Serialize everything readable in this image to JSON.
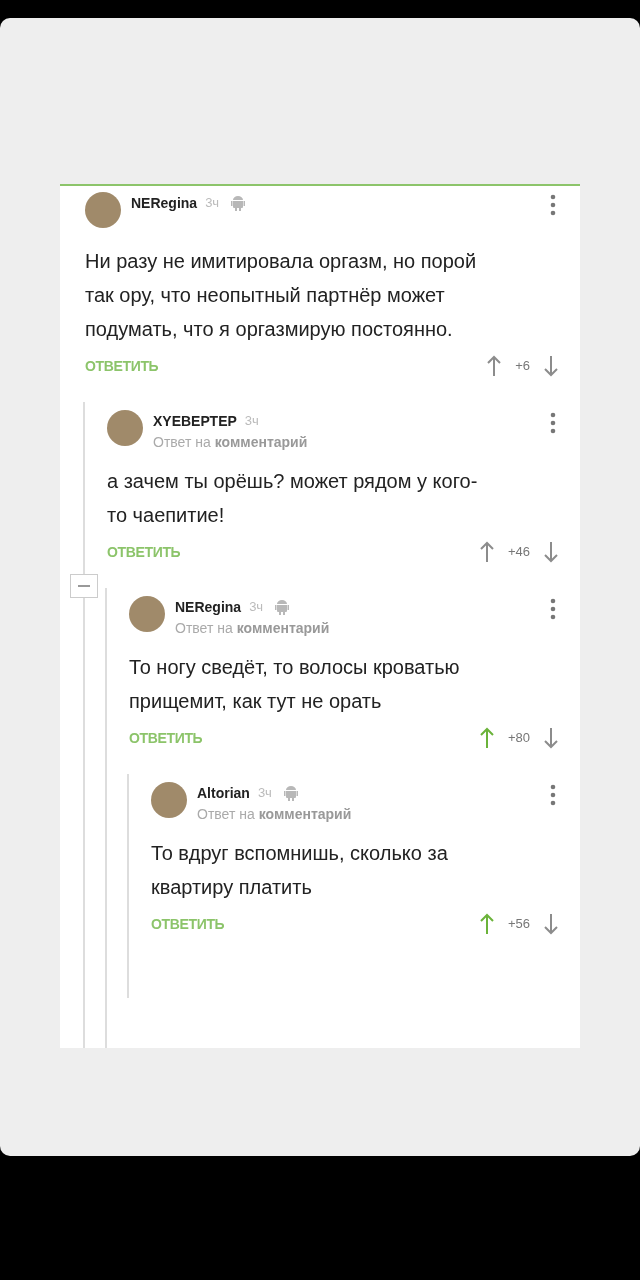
{
  "comments": [
    {
      "author": "NERegina",
      "time": "3ч",
      "android": true,
      "text": "Ни разу не имитировала оргазм, но порой так ору, что неопытный партнёр может подумать, что я оргазмирую постоянно.",
      "reply_label": "ОТВЕТИТЬ",
      "score": "+6",
      "upvoted": false,
      "children": [
        {
          "author": "ХYЕВЕРТЕР",
          "time": "3ч",
          "android": false,
          "reply_to": "Ответ на",
          "reply_target": "комментарий",
          "text": "а зачем ты орёшь? может рядом у кого-то чаепитие!",
          "reply_label": "ОТВЕТИТЬ",
          "score": "+46",
          "upvoted": false,
          "collapsible": true,
          "children": [
            {
              "author": "NERegina",
              "time": "3ч",
              "android": true,
              "reply_to": "Ответ на",
              "reply_target": "комментарий",
              "text": "То ногу сведёт, то волосы кроватью прищемит, как тут не орать",
              "reply_label": "ОТВЕТИТЬ",
              "score": "+80",
              "upvoted": true,
              "children": [
                {
                  "author": "Altorian",
                  "time": "3ч",
                  "android": true,
                  "reply_to": "Ответ на",
                  "reply_target": "комментарий",
                  "text": "То вдруг вспомнишь, сколько за квартиру платить",
                  "reply_label": "ОТВЕТИТЬ",
                  "score": "+56",
                  "upvoted": true
                }
              ]
            }
          ]
        }
      ]
    }
  ]
}
